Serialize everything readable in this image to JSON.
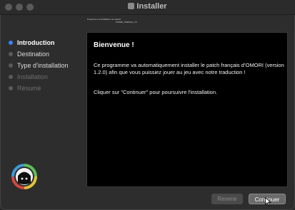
{
  "window": {
    "title": "Installer"
  },
  "header": {
    "caption_line1": "Programme d'installation du logiciel",
    "caption_line2": "OMORI_FRENCH_V3"
  },
  "sidebar": {
    "steps": [
      {
        "label": "Introduction",
        "state": "active"
      },
      {
        "label": "Destination",
        "state": "done"
      },
      {
        "label": "Type d’installation",
        "state": "done"
      },
      {
        "label": "Installation",
        "state": "pending"
      },
      {
        "label": "Résumé",
        "state": "pending"
      }
    ]
  },
  "panel": {
    "heading": "Bienvenue !",
    "paragraph1": "Ce programme va automatiquement installer le patch français d’OMORI (version 1.2.0) afin que vous puissiez jouer au jeu avec notre traduction !",
    "paragraph2": "Cliquer sur \"Continuer\" pour poursuivre l'installation."
  },
  "buttons": {
    "back": "Revenir",
    "continue": "Continuer"
  },
  "colors": {
    "accent": "#3b82f6",
    "panel_bg": "#000000",
    "window_bg": "#2d2d2d"
  }
}
